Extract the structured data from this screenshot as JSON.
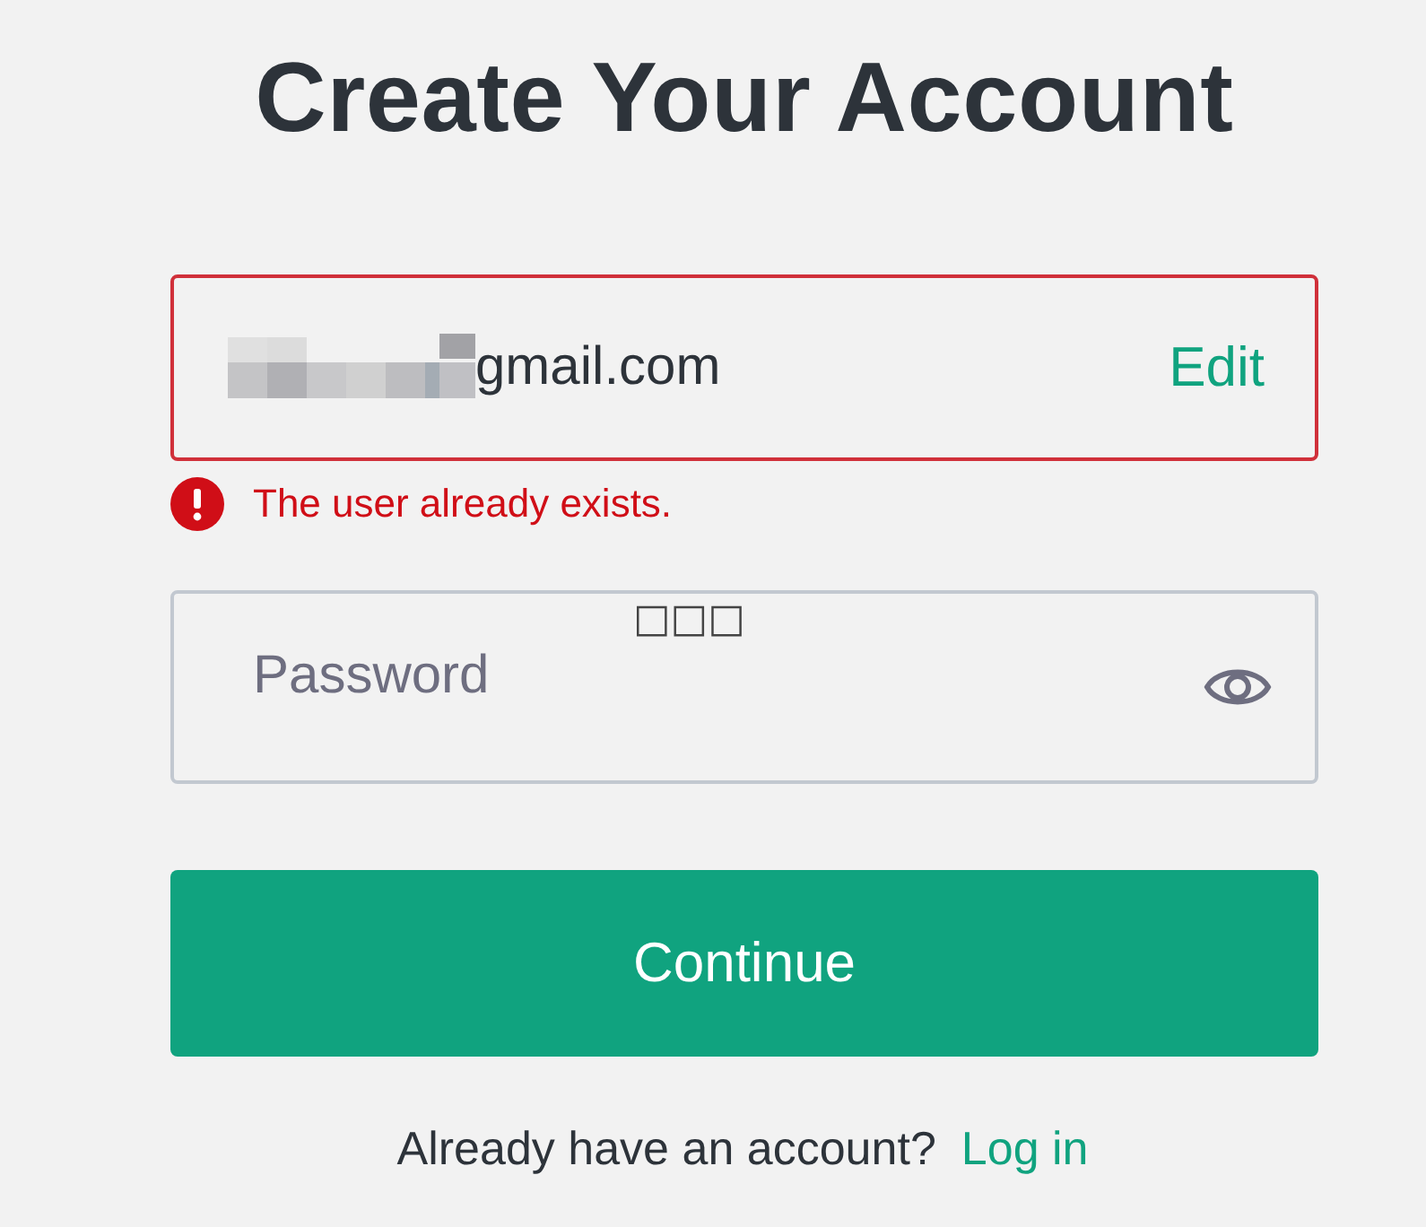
{
  "title": "Create Your Account",
  "email_field": {
    "value": "gmail.com",
    "redacted": true,
    "error": true,
    "action": "Edit"
  },
  "error_message": "The user already exists.",
  "password_field": {
    "placeholder": "Password",
    "overlay_text": "□□□"
  },
  "continue_button": "Continue",
  "footer": {
    "prompt": "Already have an account?",
    "link": "Log in"
  }
}
